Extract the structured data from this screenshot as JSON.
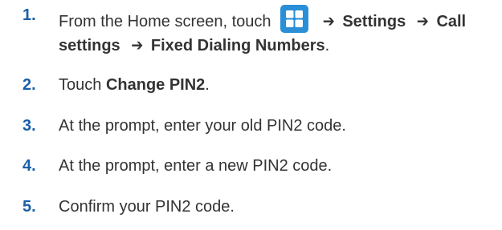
{
  "steps": [
    {
      "number": "1.",
      "line1": {
        "prefix": "From the Home screen, touch",
        "arrow1": "➔",
        "settings": "Settings",
        "arrow2": "➔",
        "call": "Call"
      },
      "line2": {
        "settings": "settings",
        "arrow": "➔",
        "fdn": "Fixed Dialing Numbers",
        "period": "."
      }
    },
    {
      "number": "2.",
      "prefix": "Touch ",
      "bold": "Change PIN2",
      "suffix": "."
    },
    {
      "number": "3.",
      "text": "At the prompt, enter your old PIN2 code."
    },
    {
      "number": "4.",
      "text": "At the prompt, enter a new PIN2 code."
    },
    {
      "number": "5.",
      "text": "Confirm your PIN2 code."
    }
  ],
  "colors": {
    "step_number": "#1a5fa8",
    "body_text": "#333333",
    "home_icon_bg": "#2a8fd6",
    "home_icon_tile": "#ffffff"
  },
  "icons": {
    "apps": "apps-grid-icon"
  }
}
